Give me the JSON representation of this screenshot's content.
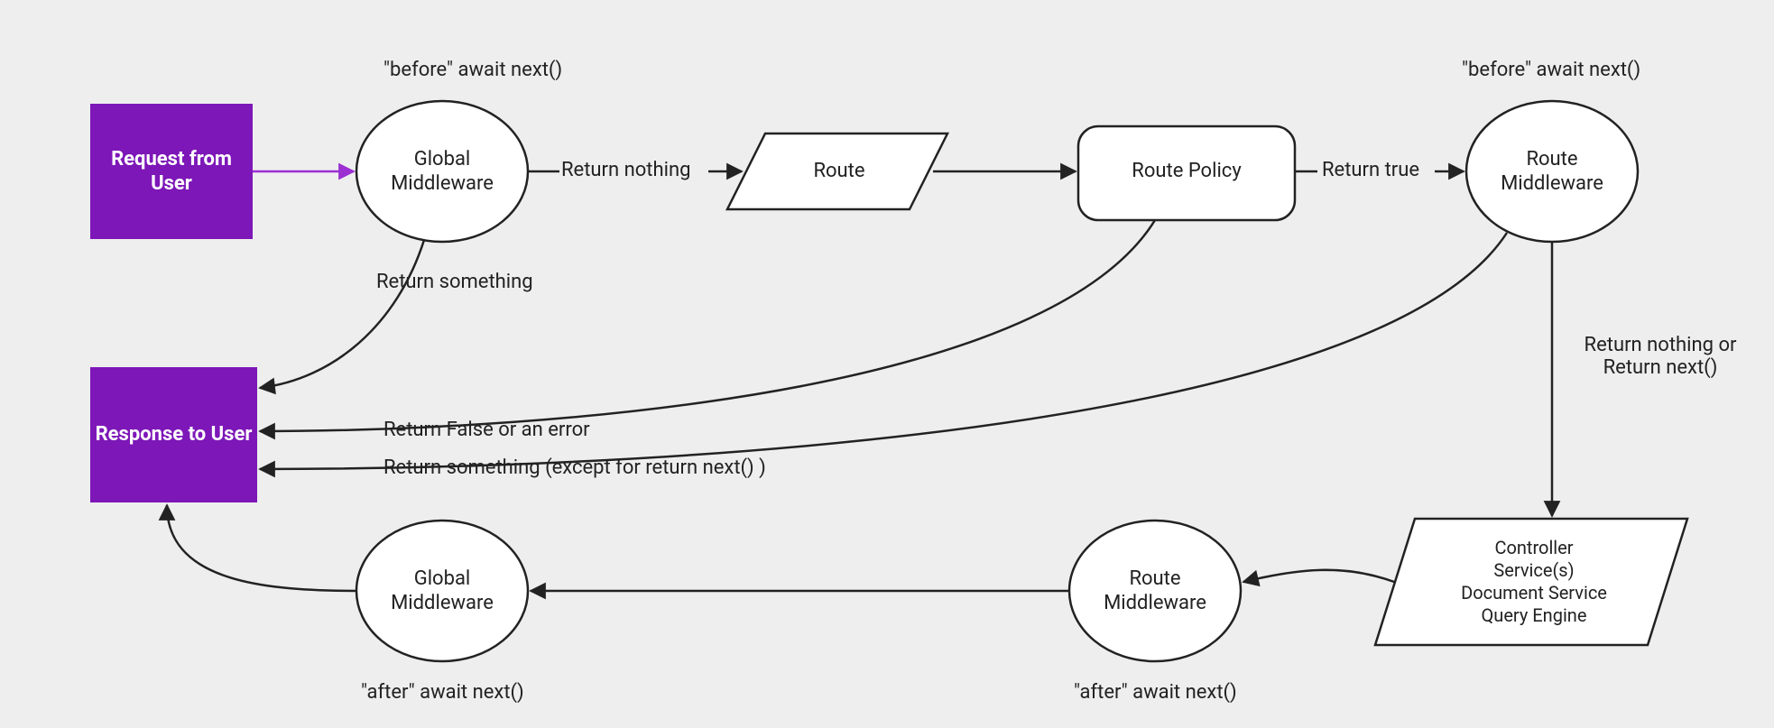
{
  "nodes": {
    "request": "Request from User",
    "response": "Response to User",
    "global_mw_top": "Global\nMiddleware",
    "global_mw_bottom": "Global\nMiddleware",
    "route": "Route",
    "route_policy": "Route Policy",
    "route_mw_top": "Route\nMiddleware",
    "route_mw_bottom": "Route\nMiddleware",
    "controller": "Controller\nService(s)\nDocument Service\nQuery Engine"
  },
  "labels": {
    "before_top_left": "\"before\" await next()",
    "before_top_right": "\"before\" await next()",
    "return_nothing": "Return nothing",
    "return_true": "Return true",
    "return_something": "Return something",
    "return_false_error": "Return False or an error",
    "return_something_except": "Return something (except for return next() )",
    "return_nothing_or_next": "Return nothing\nor\nReturn next()",
    "after_left": "\"after\" await next()",
    "after_right": "\"after\" await next()"
  },
  "colors": {
    "purple": "#7d17b8",
    "purple_stroke": "#9b2fd1",
    "stroke": "#222222",
    "bg": "#eeeeee"
  }
}
